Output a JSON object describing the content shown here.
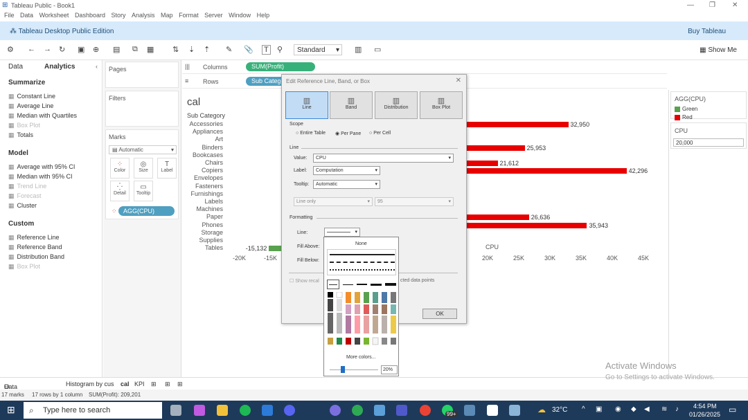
{
  "window": {
    "title": "Tableau Public - Book1"
  },
  "menu": [
    "File",
    "Data",
    "Worksheet",
    "Dashboard",
    "Story",
    "Analysis",
    "Map",
    "Format",
    "Server",
    "Window",
    "Help"
  ],
  "banner": {
    "edition": "Tableau Desktop Public Edition",
    "buy": "Buy Tableau"
  },
  "toolbar": {
    "fit": "Standard",
    "show_me": "Show Me"
  },
  "left_pane": {
    "tab_data": "Data",
    "tab_analytics": "Analytics",
    "summarize": {
      "title": "Summarize",
      "items": [
        "Constant Line",
        "Average Line",
        "Median with Quartiles",
        "Box Plot",
        "Totals"
      ]
    },
    "model": {
      "title": "Model",
      "items": [
        "Average with 95% CI",
        "Median with 95% CI",
        "Trend Line",
        "Forecast",
        "Cluster"
      ]
    },
    "custom": {
      "title": "Custom",
      "items": [
        "Reference Line",
        "Reference Band",
        "Distribution Band",
        "Box Plot"
      ]
    }
  },
  "cards": {
    "pages": "Pages",
    "filters": "Filters",
    "marks": "Marks",
    "mark_type": "Automatic",
    "buttons": [
      "Color",
      "Size",
      "Label",
      "Detail",
      "Tooltip"
    ],
    "pill": "AGG(CPU)"
  },
  "shelves": {
    "columns_label": "Columns",
    "columns_pill": "SUM(Profit)",
    "rows_label": "Rows",
    "rows_pill": "Sub Category"
  },
  "view": {
    "title": "cal",
    "header": "Sub Category",
    "ref_line_label": "CPU"
  },
  "chart_data": {
    "type": "bar",
    "categories": [
      "Accessories",
      "Appliances",
      "Art",
      "Binders",
      "Bookcases",
      "Chairs",
      "Copiers",
      "Envelopes",
      "Fasteners",
      "Furnishings",
      "Labels",
      "Machines",
      "Paper",
      "Phones",
      "Storage",
      "Supplies",
      "Tables"
    ],
    "visible_values": {
      "Accessories": 32950,
      "Binders": 25953,
      "Chairs": 21612,
      "Copiers": 42296,
      "Paper": 26636,
      "Phones": 35943,
      "Tables": -15132
    },
    "data_labels": {
      "Accessories": "32,950",
      "Binders": "25,953",
      "Chairs": "21,612",
      "Copiers": "42,296",
      "Paper": "26,636",
      "Phones": "35,943",
      "Tables": "-15,132"
    },
    "x_ticks": [
      "-20K",
      "-15K",
      "20K",
      "25K",
      "30K",
      "35K",
      "40K",
      "45K"
    ],
    "xlim": [
      -20000,
      45000
    ],
    "colors": {
      "Green": "#59a14f",
      "Red": "#e80000"
    }
  },
  "legend": {
    "title": "AGG(CPU)",
    "items": [
      "Green",
      "Red"
    ],
    "param_title": "CPU",
    "param_value": "20,000"
  },
  "dialog": {
    "title": "Edit Reference Line, Band, or Box",
    "types": [
      "Line",
      "Band",
      "Distribution",
      "Box Plot"
    ],
    "scope_title": "Scope",
    "scope_options": [
      "Entire Table",
      "Per Pane",
      "Per Cell"
    ],
    "line_title": "Line",
    "value_label": "Value:",
    "value": "CPU",
    "label_label": "Label:",
    "label_value": "Computation",
    "tooltip_label": "Tooltip:",
    "tooltip_value": "Automatic",
    "ci_select": "Line only",
    "ci_value": "95",
    "formatting_title": "Formatting",
    "line_label": "Line:",
    "fill_above": "Fill Above:",
    "fill_below": "Fill Below:",
    "show_recalc": "Show recal",
    "highlighted": "cted data points",
    "ok": "OK"
  },
  "popup": {
    "none": "None",
    "more_colors": "More colors...",
    "opacity": "20%"
  },
  "sheet_tabs": [
    "Data Source",
    "Histogram by cus",
    "cal",
    "KPI"
  ],
  "status": {
    "marks": "17 marks",
    "rows": "17 rows by 1 column",
    "sum": "SUM(Profit): 209,201"
  },
  "watermark": {
    "line1": "Activate Windows",
    "line2": "Go to Settings to activate Windows."
  },
  "taskbar": {
    "search": "Type here to search",
    "weather": "32°C",
    "time": "4:54 PM",
    "date": "01/26/2025",
    "badge": "99+"
  }
}
